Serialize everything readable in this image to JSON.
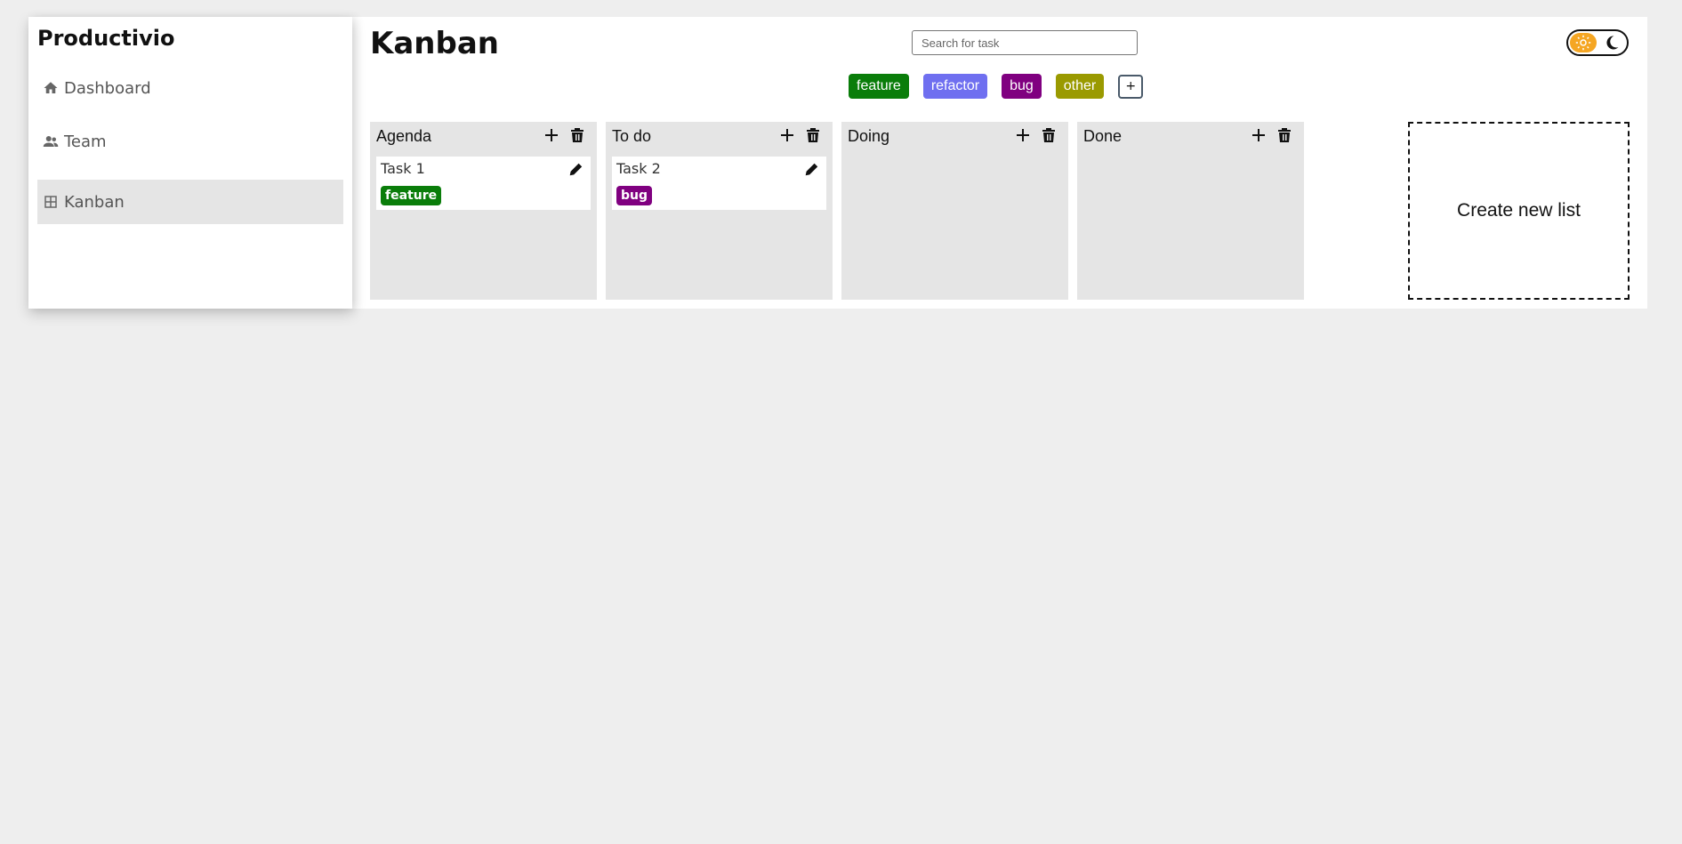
{
  "sidebar": {
    "brand": "Productivio",
    "items": [
      {
        "label": "Dashboard",
        "icon": "home-icon"
      },
      {
        "label": "Team",
        "icon": "users-icon"
      },
      {
        "label": "Kanban",
        "icon": "table-icon",
        "active": true
      }
    ]
  },
  "header": {
    "title": "Kanban",
    "search_placeholder": "Search for task"
  },
  "tags": [
    {
      "label": "feature",
      "color": "#0a7d0a"
    },
    {
      "label": "refactor",
      "color": "#6f6ff0"
    },
    {
      "label": "bug",
      "color": "#800080"
    },
    {
      "label": "other",
      "color": "#9a9a00"
    }
  ],
  "tag_add_label": "+",
  "lists": [
    {
      "title": "Agenda",
      "cards": [
        {
          "title": "Task 1",
          "tag": "feature",
          "tag_color": "#0a7d0a"
        }
      ]
    },
    {
      "title": "To do",
      "cards": [
        {
          "title": "Task 2",
          "tag": "bug",
          "tag_color": "#800080"
        }
      ]
    },
    {
      "title": "Doing",
      "cards": []
    },
    {
      "title": "Done",
      "cards": []
    }
  ],
  "create_list_label": "Create new list",
  "theme": {
    "mode": "light",
    "accent": "#f5a623"
  }
}
